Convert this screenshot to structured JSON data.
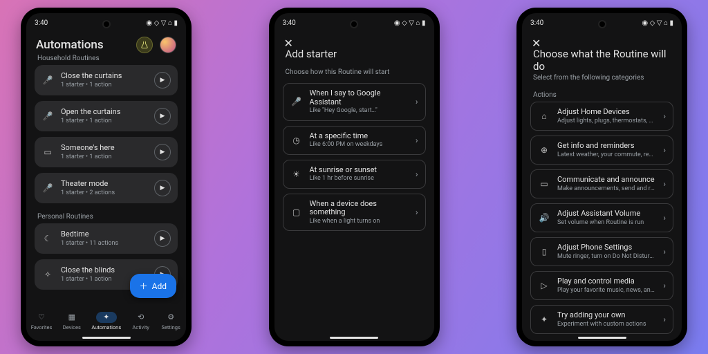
{
  "status": {
    "time": "3:40",
    "icons": "◉ ◇ ▽ ⌂ ▮"
  },
  "phone1": {
    "title": "Automations",
    "section1": "Household Routines",
    "section2": "Personal Routines",
    "routines1": [
      {
        "icon": "mic",
        "title": "Close the curtains",
        "sub": "1 starter • 1 action"
      },
      {
        "icon": "mic",
        "title": "Open the curtains",
        "sub": "1 starter • 1 action"
      },
      {
        "icon": "cast",
        "title": "Someone's here",
        "sub": "1 starter • 1 action"
      },
      {
        "icon": "mic",
        "title": "Theater mode",
        "sub": "1 starter • 2 actions"
      }
    ],
    "routines2": [
      {
        "icon": "moon",
        "title": "Bedtime",
        "sub": "1 starter • 11 actions"
      },
      {
        "icon": "wand",
        "title": "Close the blinds",
        "sub": "1 starter • 1 action"
      }
    ],
    "fab": "Add",
    "nav": [
      {
        "label": "Favorites"
      },
      {
        "label": "Devices"
      },
      {
        "label": "Automations"
      },
      {
        "label": "Activity"
      },
      {
        "label": "Settings"
      }
    ]
  },
  "phone2": {
    "title": "Add starter",
    "subtitle": "Choose how this Routine will start",
    "items": [
      {
        "icon": "mic",
        "title": "When I say to Google Assistant",
        "sub": "Like \"Hey Google, start…\""
      },
      {
        "icon": "clock",
        "title": "At a specific time",
        "sub": "Like 6:00 PM on weekdays"
      },
      {
        "icon": "sun",
        "title": "At sunrise or sunset",
        "sub": "Like 1 hr before sunrise"
      },
      {
        "icon": "device",
        "title": "When a device does something",
        "sub": "Like when a light turns on"
      }
    ]
  },
  "phone3": {
    "title": "Choose what the Routine will do",
    "subtitle": "Select from the following categories",
    "section": "Actions",
    "items": [
      {
        "icon": "home",
        "title": "Adjust Home Devices",
        "sub": "Adjust lights, plugs, thermostats, and more"
      },
      {
        "icon": "info",
        "title": "Get info and reminders",
        "sub": "Latest weather, your commute, reminders"
      },
      {
        "icon": "chat",
        "title": "Communicate and announce",
        "sub": "Make announcements, send and read texts"
      },
      {
        "icon": "volume",
        "title": "Adjust Assistant Volume",
        "sub": "Set volume when Routine is run"
      },
      {
        "icon": "phone",
        "title": "Adjust Phone Settings",
        "sub": "Mute ringer, turn on Do Not Disturb, and …"
      },
      {
        "icon": "play",
        "title": "Play and control media",
        "sub": "Play your favorite music, news, and more"
      },
      {
        "icon": "sparkle",
        "title": "Try adding your own",
        "sub": "Experiment with custom actions"
      }
    ]
  },
  "iconGlyphs": {
    "mic": "🎤",
    "cast": "▭",
    "moon": "☾",
    "wand": "✧",
    "clock": "◷",
    "sun": "☀",
    "device": "▢",
    "home": "⌂",
    "info": "⊕",
    "chat": "▭",
    "volume": "🔊",
    "phone": "▯",
    "play": "▷",
    "sparkle": "✦"
  }
}
